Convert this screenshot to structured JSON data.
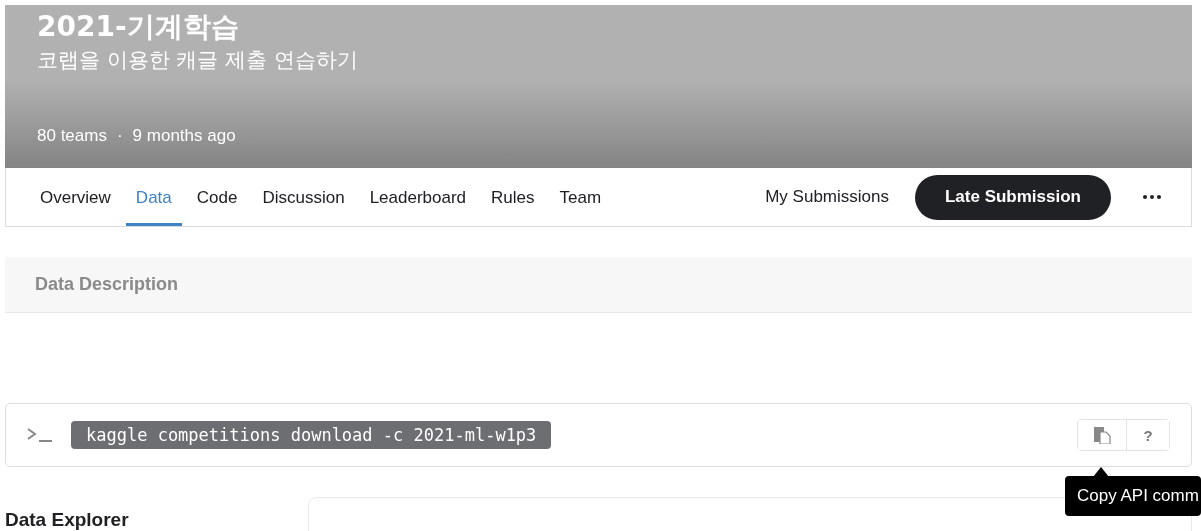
{
  "header": {
    "title": "2021-기계학습",
    "subtitle": "코랩을 이용한 캐글 제출 연습하기",
    "teams": "80 teams",
    "separator": "·",
    "age": "9 months ago"
  },
  "tabs": [
    {
      "label": "Overview",
      "selected": false
    },
    {
      "label": "Data",
      "selected": true
    },
    {
      "label": "Code",
      "selected": false
    },
    {
      "label": "Discussion",
      "selected": false
    },
    {
      "label": "Leaderboard",
      "selected": false
    },
    {
      "label": "Rules",
      "selected": false
    },
    {
      "label": "Team",
      "selected": false
    }
  ],
  "actions": {
    "my_submissions": "My Submissions",
    "late_submission": "Late Submission"
  },
  "data_description": {
    "title": "Data Description"
  },
  "api_command": {
    "command": "kaggle competitions download -c 2021-ml-w1p3",
    "help": "?",
    "tooltip": "Copy API comm"
  },
  "data_explorer": {
    "title": "Data Explorer"
  }
}
